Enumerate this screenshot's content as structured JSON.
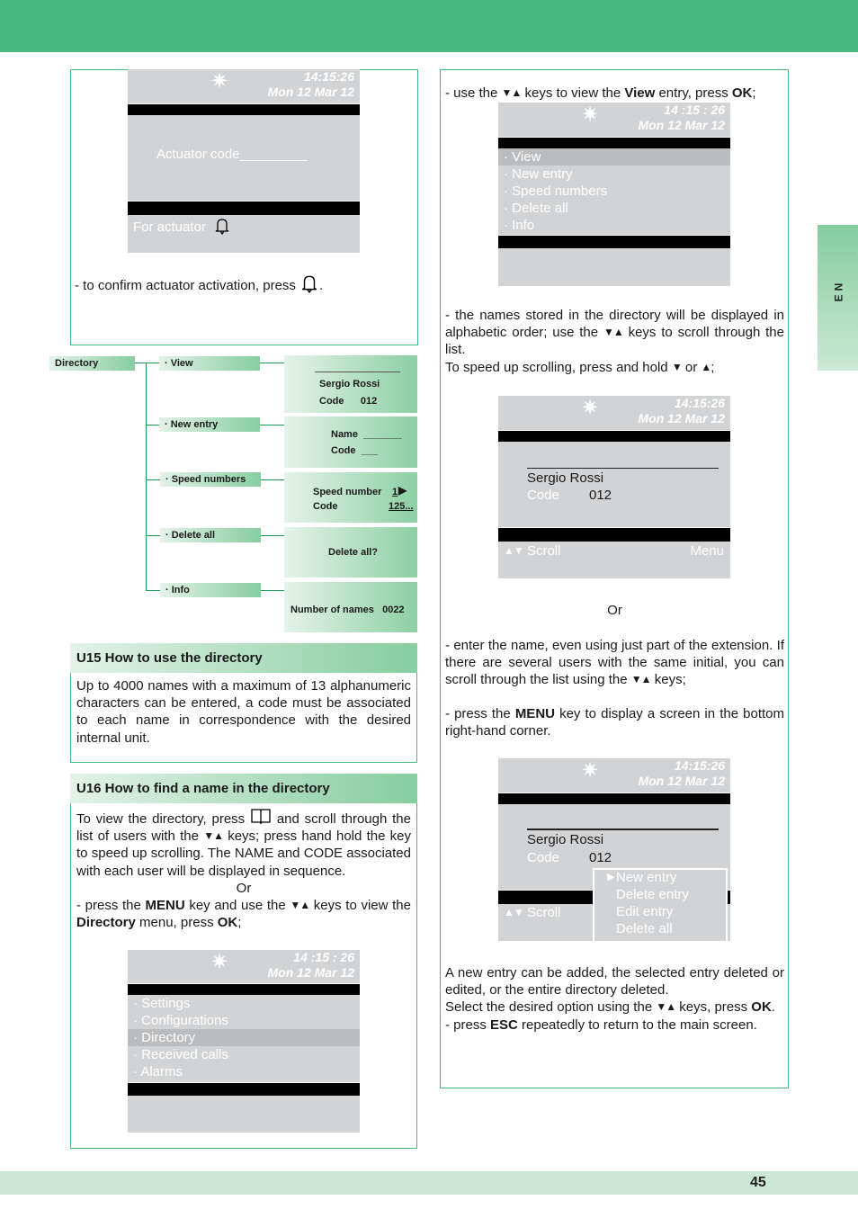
{
  "page": {
    "language_tab": "EN",
    "page_number": "45",
    "accent_color": "#47b97d"
  },
  "actuator_panel": {
    "screen": {
      "time": "14:15:26",
      "date": "Mon 12 Mar 12",
      "field_label": "Actuator code",
      "field_value": "_________",
      "footer": "For actuator",
      "footer_icon": "bell-icon"
    },
    "instruction": "- to confirm actuator activation, press",
    "instruction_icon": "bell-icon",
    "instruction_end": "."
  },
  "tree": {
    "root": "Directory",
    "branches": [
      {
        "label": "· View",
        "screen": [
          "Sergio Rossi",
          "Code      012"
        ]
      },
      {
        "label": "· New entry",
        "screen": [
          "Name  _______",
          "Code  ___"
        ]
      },
      {
        "label": "· Speed numbers",
        "screen": [
          "Speed number",
          "1",
          "Code",
          "125..."
        ]
      },
      {
        "label": "· Delete all",
        "screen": [
          "Delete all?"
        ]
      },
      {
        "label": "· Info",
        "screen": [
          "Number of names   0022"
        ]
      }
    ]
  },
  "u15": {
    "title": "U15 How to use the directory",
    "body": "Up to 4000 names with a maximum of 13 alphanumeric characters can be entered, a code must be associated to each name in correspondence with the desired internal unit."
  },
  "u16": {
    "title": "U16 How to find a name in the directory",
    "p1_a": "To view the directory, press",
    "p1_icon": "book-icon",
    "p1_b": "and scroll through the list of users with the",
    "p1_c": "keys; press hand hold the key to speed up scrolling. The NAME and CODE associated with each user will be displayed in sequence.",
    "or": "Or",
    "p2_a": "- press the",
    "p2_menu": "MENU",
    "p2_b": "key and use the",
    "p2_c": "keys to view the",
    "p2_dir": "Directory",
    "p2_d": "menu, press",
    "p2_ok": "OK",
    "p2_e": ";",
    "screen": {
      "time": "14 :15 : 26",
      "date": "Mon 12 Mar 12",
      "items": [
        "· Settings",
        "· Configurations",
        "· Directory",
        "· Received calls",
        "· Alarms"
      ],
      "selected_index": 2
    }
  },
  "right": {
    "p1_a": "- use the",
    "p1_b": "keys to view the",
    "p1_view": "View",
    "p1_c": "entry, press",
    "p1_ok": "OK",
    "p1_d": ";",
    "screen1": {
      "time": "14 :15 : 26",
      "date": "Mon 12 Mar 12",
      "items": [
        "· View",
        "· New entry",
        "· Speed numbers",
        "· Delete all",
        "· Info"
      ],
      "selected_index": 0
    },
    "p2_a": "- the names stored in the directory will be displayed in alphabetic order; use the",
    "p2_b": "keys to scroll through the list.",
    "p2_c": "To speed up scrolling, press and hold",
    "p2_or": "or",
    "p2_d": ";",
    "screen2": {
      "time": "14:15:26",
      "date": "Mon 12 Mar 12",
      "name": "Sergio Rossi",
      "code_label": "Code",
      "code_value": "012",
      "scroll_label": "Scroll",
      "menu_label": "Menu"
    },
    "or": "Or",
    "p3_a": "- enter the name, even using just part of the extension. If there are several users with the same initial, you can scroll through the list using the",
    "p3_b": "keys;",
    "p4_a": "- press the",
    "p4_menu": "MENU",
    "p4_b": "key to display a screen in the bottom right-hand corner.",
    "screen3": {
      "time": "14:15:26",
      "date": "Mon 12 Mar 12",
      "name": "Sergio Rossi",
      "code_label": "Code",
      "code_value": "012",
      "scroll_label": "Scroll",
      "popup_items": [
        "New entry",
        "Delete entry",
        "Edit entry",
        "Delete all"
      ],
      "popup_selected_index": 0
    },
    "p5": "A new entry can be added, the selected entry deleted or edited, or the entire directory deleted.",
    "p6_a": "Select the desired option using the",
    "p6_b": "keys, press",
    "p6_ok": "OK",
    "p6_c": ".",
    "p7_a": "- press",
    "p7_esc": "ESC",
    "p7_b": "repeatedly to return to the main screen."
  }
}
